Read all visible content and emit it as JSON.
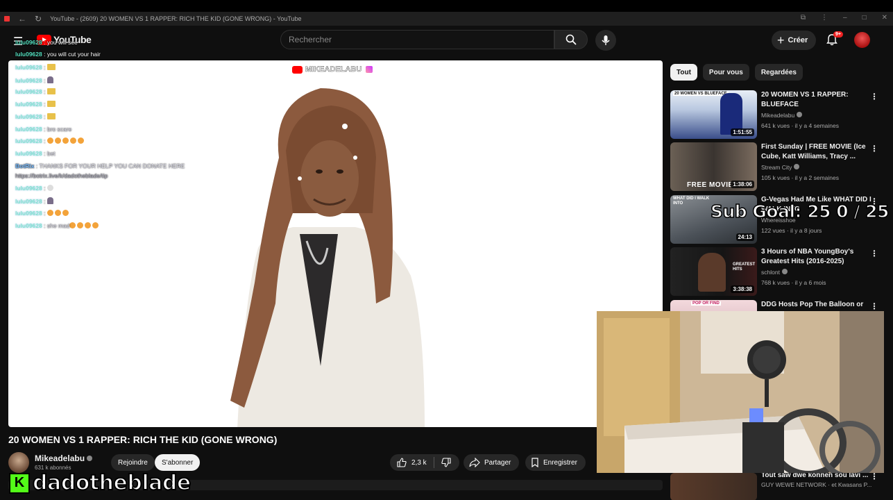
{
  "browser": {
    "tab_title": "YouTube - (2609) 20 WOMEN VS 1 RAPPER: RICH THE KID (GONE WRONG) - YouTube"
  },
  "masthead": {
    "logo_text": "YouTube",
    "search_placeholder": "Rechercher",
    "create_label": "Créer",
    "notifications_badge": "9+"
  },
  "chat": {
    "messages": [
      {
        "user": "lulu09628",
        "text": "you will see"
      },
      {
        "user": "lulu09628",
        "text": "you will cut your hair"
      },
      {
        "user": "lulu09628",
        "text": ""
      },
      {
        "user": "lulu09628",
        "text": ""
      },
      {
        "user": "lulu09628",
        "text": ""
      },
      {
        "user": "lulu09628",
        "text": ""
      },
      {
        "user": "lulu09628",
        "text": ""
      },
      {
        "user": "lulu09628",
        "text": "bro scare"
      },
      {
        "user": "lulu09628",
        "text": ""
      },
      {
        "user": "lulu09628",
        "text": "bet"
      },
      {
        "user": "BotRix",
        "text": "THANKS FOR YOUR HELP YOU CAN DONATE HERE"
      },
      {
        "user": "",
        "text": "https://botrix.live/k/dadotheblade/tip"
      },
      {
        "user": "lulu09628",
        "text": ""
      },
      {
        "user": "lulu09628",
        "text": ""
      },
      {
        "user": "lulu09628",
        "text": ""
      },
      {
        "user": "lulu09628",
        "text": "she mad"
      }
    ]
  },
  "player": {
    "watermark": "MIKEADELABU"
  },
  "video": {
    "title": "20 WOMEN VS 1 RAPPER: RICH THE KID (GONE WRONG)",
    "channel": "Mikeadelabu",
    "subscribers": "631 k abonnés",
    "join_label": "Rejoindre",
    "subscribe_label": "S'abonner",
    "likes": "2,3 k",
    "share_label": "Partager",
    "save_label": "Enregistrer"
  },
  "overlay": {
    "streamer_name": "dadotheblade",
    "sub_goal": "Sub Goal: 25  0 / 25"
  },
  "sidebar": {
    "chips": [
      "Tout",
      "Pour vous",
      "Regardées"
    ],
    "recommendations": [
      {
        "title": "20 WOMEN VS 1 RAPPER: BLUEFACE",
        "channel": "Mikeadelabu",
        "meta": "641 k vues · il y a 4 semaines",
        "duration": "1:51:55",
        "thumb_label": "20 WOMEN VS BLUEFACE"
      },
      {
        "title": "First Sunday | FREE MOVIE (Ice Cube, Katt Williams, Tracy ...",
        "channel": "Stream City",
        "meta": "105 k vues · il y a 2 semaines",
        "duration": "1:38:06",
        "thumb_label": "FREE MOVIE"
      },
      {
        "title": "G-Vegas Had Me Like WHAT DID I WALK INTO",
        "channel": "Whereisshoe",
        "meta": "122 vues · il y a 8 jours",
        "duration": "24:13",
        "thumb_label": "WHAT DID I WALK INTO"
      },
      {
        "title": "3 Hours of NBA YoungBoy's Greatest Hits (2016-2025)",
        "channel": "schlont",
        "meta": "768 k vues · il y a 6 mois",
        "duration": "3:38:38",
        "thumb_label": "GREATEST HITS"
      },
      {
        "title": "DDG Hosts Pop The Balloon or",
        "channel": "",
        "meta": "",
        "duration": "",
        "thumb_label": "POP OR FIND"
      },
      {
        "title": "Tout saw dwe konnen sou lavi ...",
        "channel": "GUY WEWE NETWORK · et Kwasans P...",
        "meta": "",
        "duration": "",
        "thumb_label": ""
      }
    ]
  },
  "colors": {
    "background": "#0f0f0f",
    "chat_user": "#55e0c0",
    "kick_green": "#53fc18",
    "youtube_red": "#ff0000"
  }
}
